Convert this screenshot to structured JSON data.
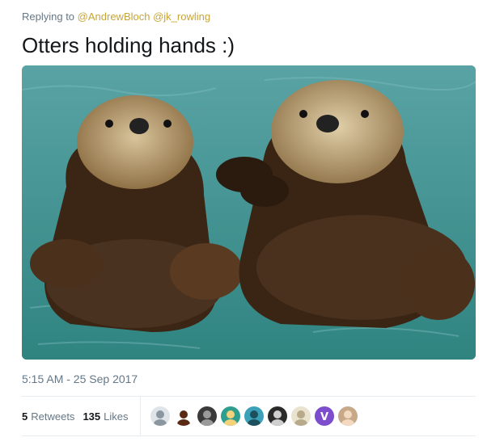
{
  "reply": {
    "prefix": "Replying to",
    "mentions": [
      "@AndrewBloch",
      "@jk_rowling"
    ]
  },
  "tweet": {
    "text": "Otters holding hands :)"
  },
  "timestamp": "5:15 AM - 25 Sep 2017",
  "stats": {
    "retweets": {
      "count": "5",
      "label": "Retweets"
    },
    "likes": {
      "count": "135",
      "label": "Likes"
    }
  },
  "colors": {
    "mention": "#c6a537",
    "muted": "#657786",
    "water": "#3e8d8a",
    "divider": "#e6ecf0"
  },
  "likers": [
    {
      "name": "liker-avatar-1",
      "bg": "#dfe4e8",
      "fg": "#8a96a0",
      "icon": "person-silhouette"
    },
    {
      "name": "liker-avatar-2",
      "bg": "#ffffff",
      "fg": "#5a2a14",
      "icon": "bird-silhouette"
    },
    {
      "name": "liker-avatar-3",
      "bg": "#3a3a3a",
      "fg": "#9a9a9a",
      "icon": "dark-photo"
    },
    {
      "name": "liker-avatar-4",
      "bg": "#2f9e8e",
      "fg": "#f4d27a",
      "icon": "cartoon"
    },
    {
      "name": "liker-avatar-5",
      "bg": "#3aa1b8",
      "fg": "#1d4f5c",
      "icon": "landscape"
    },
    {
      "name": "liker-avatar-6",
      "bg": "#2a2a2a",
      "fg": "#cfcfcf",
      "icon": "portrait-dark"
    },
    {
      "name": "liker-avatar-7",
      "bg": "#e8e2cf",
      "fg": "#b8a98a",
      "icon": "portrait-light"
    },
    {
      "name": "liker-avatar-8",
      "bg": "#7c4dcc",
      "fg": "#ffffff",
      "icon": "letter-v"
    },
    {
      "name": "liker-avatar-9",
      "bg": "#c7a98a",
      "fg": "#f2d9c0",
      "icon": "portrait-blonde"
    }
  ]
}
